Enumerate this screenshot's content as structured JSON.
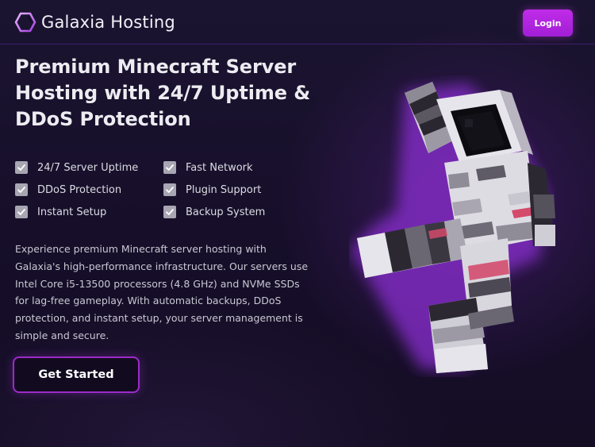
{
  "header": {
    "brand_name": "Galaxia Hosting",
    "logo_icon": "hexagon-logo-icon",
    "login_label": "Login"
  },
  "hero": {
    "title": "Premium Minecraft Server Hosting with 24/7 Uptime & DDoS Protection",
    "features": [
      {
        "label": "24/7 Server Uptime",
        "icon": "checkbox-icon"
      },
      {
        "label": "Fast Network",
        "icon": "checkbox-icon"
      },
      {
        "label": "DDoS Protection",
        "icon": "checkbox-icon"
      },
      {
        "label": "Plugin Support",
        "icon": "checkbox-icon"
      },
      {
        "label": "Instant Setup",
        "icon": "checkbox-icon"
      },
      {
        "label": "Backup System",
        "icon": "checkbox-icon"
      }
    ],
    "description": "Experience premium Minecraft server hosting with Galaxia's high-performance infrastructure. Our servers use Intel Core i5-13500 processors (4.8 GHz) and NVMe SSDs for lag-free gameplay. With automatic backups, DDoS protection, and instant setup, your server management is simple and secure.",
    "cta_label": "Get Started",
    "illustration": "minecraft-astronaut-illustration"
  },
  "colors": {
    "background": "#170f2a",
    "accent": "#a21ed6",
    "accent_border": "#9b2bc7",
    "text_primary": "#ececf1",
    "text_secondary": "#c9c7d2"
  }
}
